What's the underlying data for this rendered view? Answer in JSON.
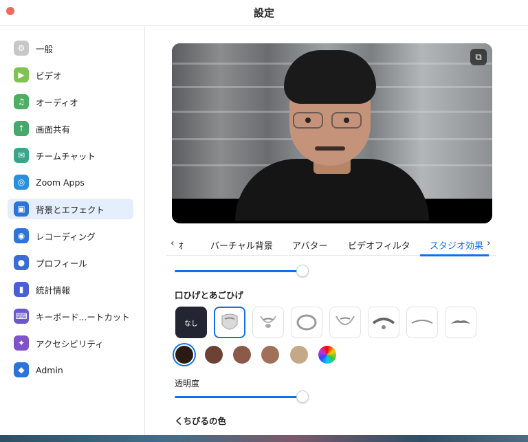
{
  "window": {
    "title": "設定"
  },
  "sidebar": {
    "items": [
      {
        "label": "一般",
        "icon": "gear-icon",
        "color": "#c7c7c7"
      },
      {
        "label": "ビデオ",
        "icon": "video-icon",
        "color": "#7fc354"
      },
      {
        "label": "オーディオ",
        "icon": "headphones-icon",
        "color": "#4fae63"
      },
      {
        "label": "画面共有",
        "icon": "share-screen-icon",
        "color": "#46a86b"
      },
      {
        "label": "チームチャット",
        "icon": "chat-icon",
        "color": "#3aa58a"
      },
      {
        "label": "Zoom Apps",
        "icon": "apps-icon",
        "color": "#2d8fd9"
      },
      {
        "label": "背景とエフェクト",
        "icon": "background-icon",
        "color": "#2d74d8"
      },
      {
        "label": "レコーディング",
        "icon": "record-icon",
        "color": "#2d74d8"
      },
      {
        "label": "プロフィール",
        "icon": "profile-icon",
        "color": "#3c6bd6"
      },
      {
        "label": "統計情報",
        "icon": "stats-icon",
        "color": "#4a5fd1"
      },
      {
        "label": "キーボード...ートカット",
        "icon": "keyboard-icon",
        "color": "#6a58cc"
      },
      {
        "label": "アクセシビリティ",
        "icon": "accessibility-icon",
        "color": "#7f54c9"
      },
      {
        "label": "Admin",
        "icon": "admin-icon",
        "color": "#2d74d8"
      }
    ],
    "active_index": 6
  },
  "preview": {
    "icon": "copy-icon"
  },
  "tabs": {
    "items": [
      "ｵ",
      "バーチャル背景",
      "アバター",
      "ビデオフィルタ",
      "スタジオ効果"
    ],
    "active_index": 4,
    "prev_arrow": "‹",
    "next_arrow": "›"
  },
  "studio": {
    "top_slider_value": 0.73,
    "beard_title": "口ひげとあごひげ",
    "beard_none_label": "なし",
    "beard_selected_index": 1,
    "beard_colors": [
      "#2b1a14",
      "#6b4234",
      "#8c5a48",
      "#a0705a",
      "#c4a888"
    ],
    "beard_color_selected_index": 0,
    "opacity_label": "透明度",
    "opacity_value": 0.73,
    "lip_title": "くちびるの色"
  },
  "colors": {
    "accent": "#0e71eb"
  }
}
